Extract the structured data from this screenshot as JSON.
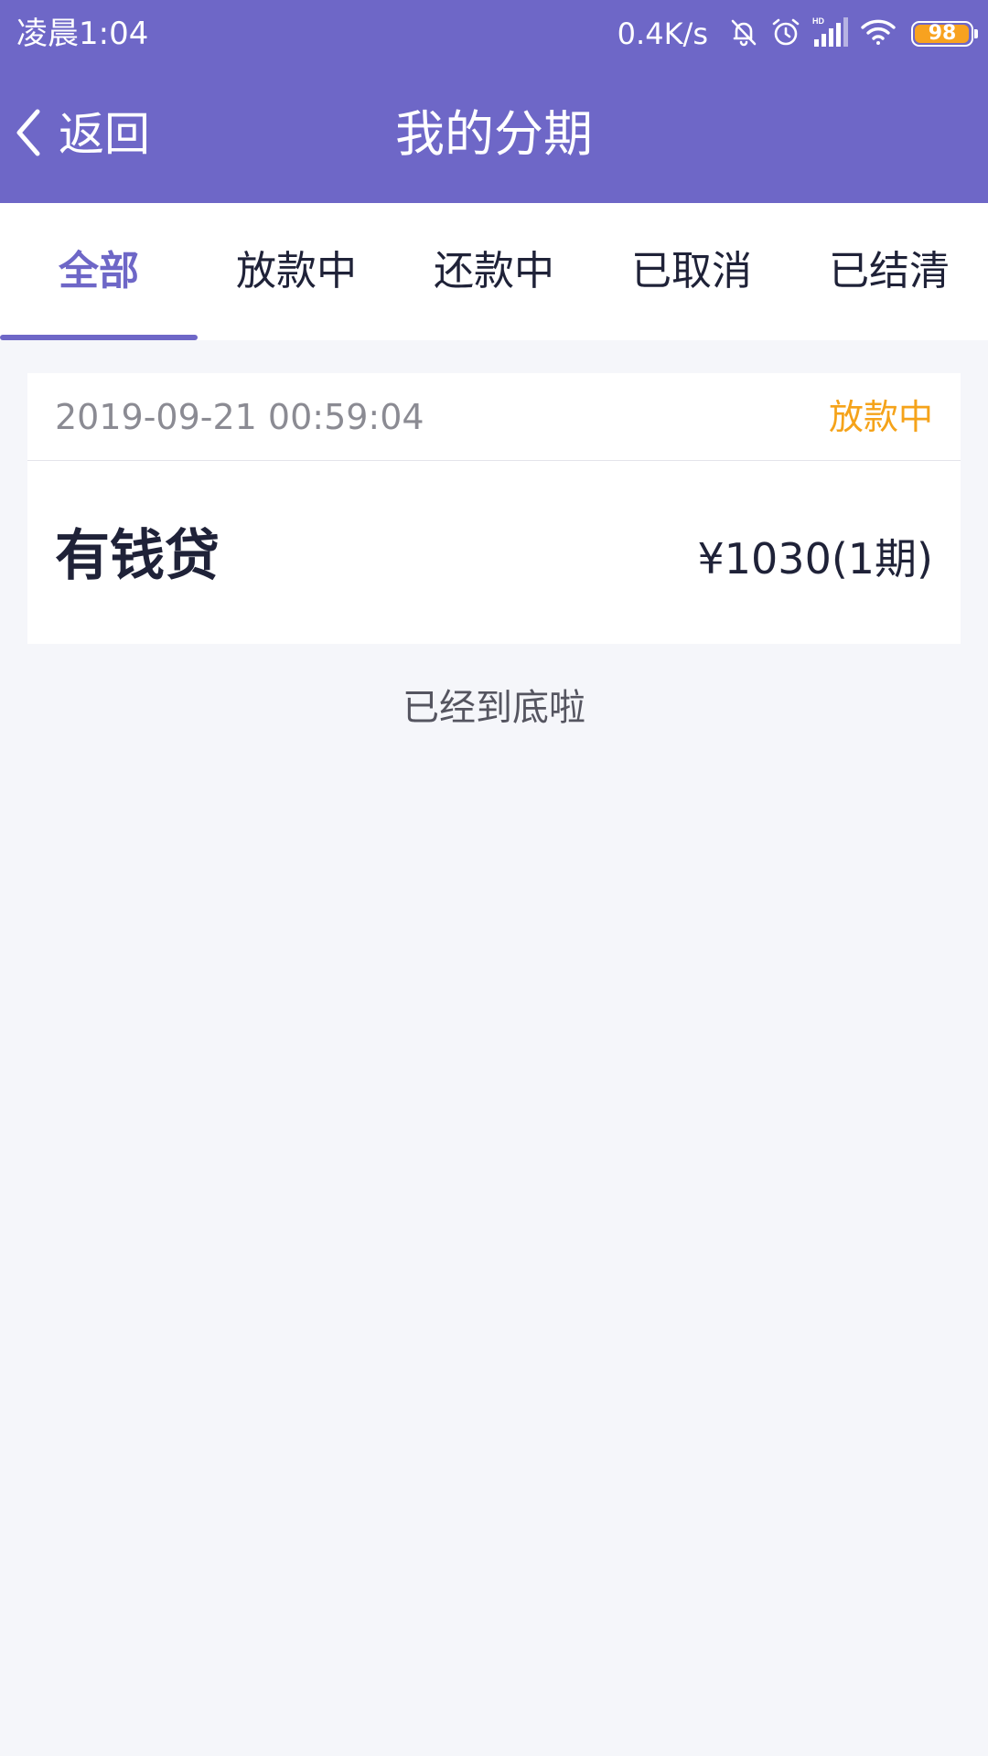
{
  "status_bar": {
    "time": "凌晨1:04",
    "net_speed": "0.4K/s",
    "battery_level": "98",
    "battery_fraction": 0.98,
    "icons": [
      "mute-bell-icon",
      "alarm-icon",
      "hd-signal-icon",
      "wifi-icon",
      "battery-icon"
    ]
  },
  "nav": {
    "back_label": "返回",
    "title": "我的分期"
  },
  "tabs": [
    {
      "label": "全部",
      "active": true
    },
    {
      "label": "放款中",
      "active": false
    },
    {
      "label": "还款中",
      "active": false
    },
    {
      "label": "已取消",
      "active": false
    },
    {
      "label": "已结清",
      "active": false
    }
  ],
  "orders": [
    {
      "date": "2019-09-21 00:59:04",
      "status": "放款中",
      "product": "有钱贷",
      "amount": "¥1030(1期)"
    }
  ],
  "list_end_text": "已经到底啦",
  "colors": {
    "primary": "#6e67c7",
    "status_pending": "#f5a31a",
    "battery": "#f8a21f",
    "background": "#f5f6fa"
  }
}
